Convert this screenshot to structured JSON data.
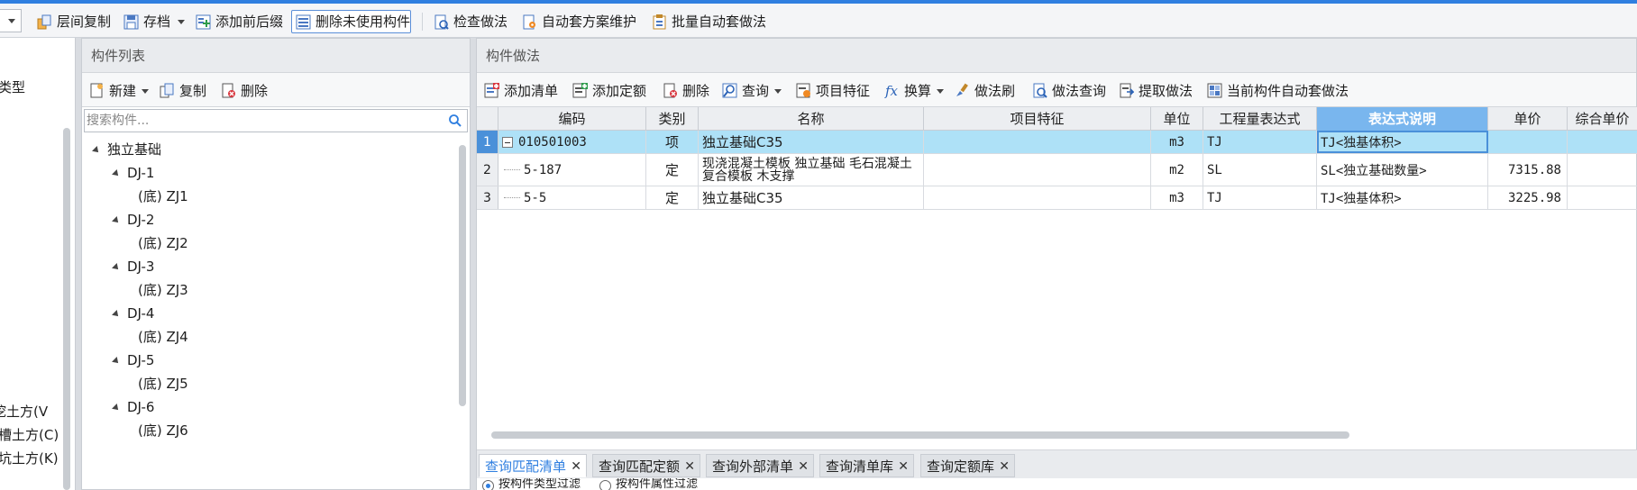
{
  "toolbar": {
    "floor_copy": "层间复制",
    "save": "存档",
    "add_prefix_suffix": "添加前后缀",
    "delete_unused": "删除未使用构件",
    "check_method": "检查做法",
    "auto_scheme": "自动套方案维护",
    "batch_auto": "批量自动套做法"
  },
  "left_panel": {
    "type_label": "类型",
    "items": [
      "挖土方(V",
      "槽土方(C)",
      "坑土方(K)"
    ]
  },
  "component_list": {
    "title": "构件列表",
    "new": "新建",
    "copy": "复制",
    "delete": "删除",
    "search_placeholder": "搜索构件...",
    "tree": {
      "root": "独立基础",
      "groups": [
        {
          "name": "DJ-1",
          "child": "(底) ZJ1"
        },
        {
          "name": "DJ-2",
          "child": "(底) ZJ2"
        },
        {
          "name": "DJ-3",
          "child": "(底) ZJ3"
        },
        {
          "name": "DJ-4",
          "child": "(底) ZJ4"
        },
        {
          "name": "DJ-5",
          "child": "(底) ZJ5"
        },
        {
          "name": "DJ-6",
          "child": "(底) ZJ6"
        }
      ]
    }
  },
  "method_panel": {
    "title": "构件做法",
    "add_bill": "添加清单",
    "add_quota": "添加定额",
    "delete": "删除",
    "query": "查询",
    "item_feature": "项目特征",
    "convert": "换算",
    "brush": "做法刷",
    "method_query": "做法查询",
    "extract": "提取做法",
    "auto_current": "当前构件自动套做法",
    "columns": [
      "编码",
      "类别",
      "名称",
      "项目特征",
      "单位",
      "工程量表达式",
      "表达式说明",
      "单价",
      "综合单价"
    ],
    "rows": [
      {
        "num": "1",
        "code": "010501003",
        "type": "项",
        "name": "独立基础C35",
        "feature": "",
        "unit": "m3",
        "expr": "TJ",
        "expr_desc": "TJ<独基体积>",
        "price": "",
        "comp_price": ""
      },
      {
        "num": "2",
        "code": "5-187",
        "type": "定",
        "name": "现浇混凝土模板 独立基础 毛石混凝土 复合模板 木支撑",
        "feature": "",
        "unit": "m2",
        "expr": "SL",
        "expr_desc": "SL<独立基础数量>",
        "price": "7315.88",
        "comp_price": ""
      },
      {
        "num": "3",
        "code": "5-5",
        "type": "定",
        "name": "独立基础C35",
        "feature": "",
        "unit": "m3",
        "expr": "TJ",
        "expr_desc": "TJ<独基体积>",
        "price": "3225.98",
        "comp_price": ""
      }
    ]
  },
  "bottom_tabs": [
    "查询匹配清单",
    "查询匹配定额",
    "查询外部清单",
    "查询清单库",
    "查询定额库"
  ],
  "bottom_options": [
    "按构件类型过滤",
    "按构件属性过滤"
  ],
  "colors": {
    "accent": "#2f7fe0",
    "selection": "#aee1f7",
    "header_highlight": "#79b6ee"
  }
}
